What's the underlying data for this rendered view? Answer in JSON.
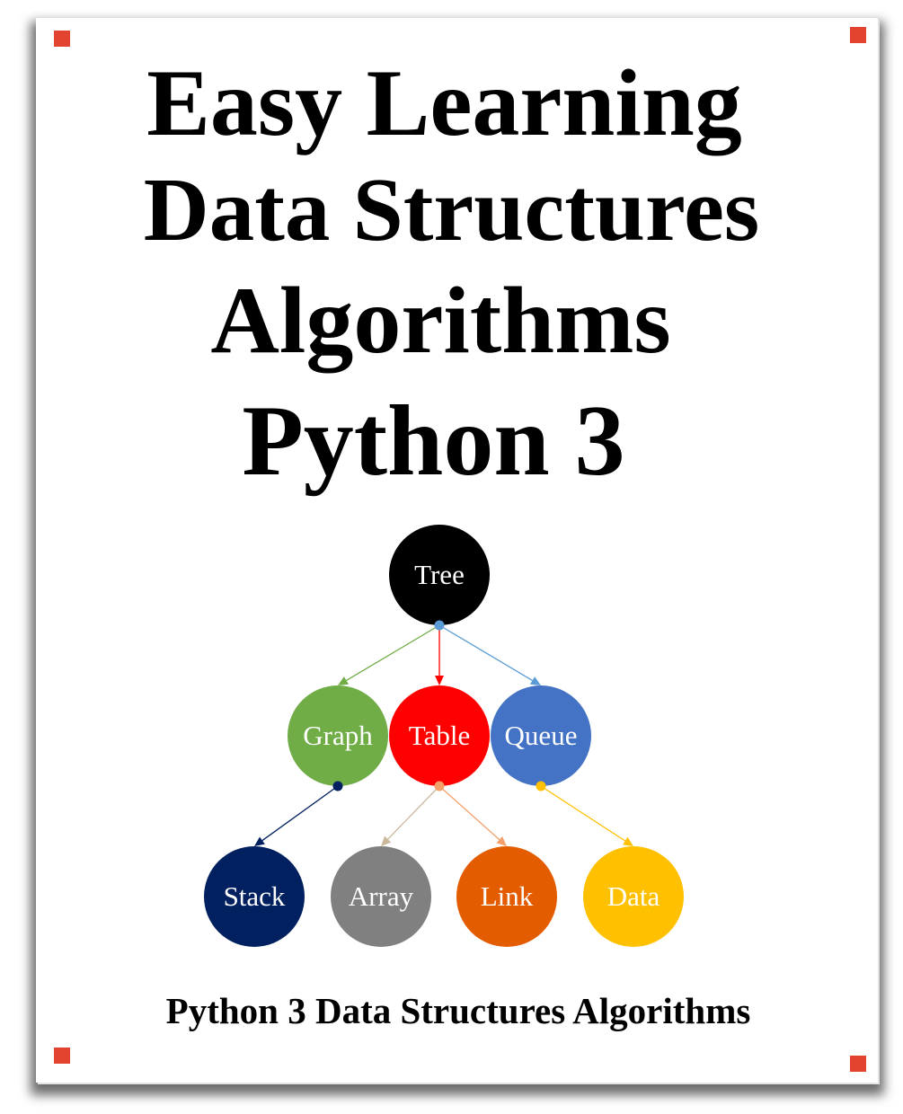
{
  "cover": {
    "title_lines": [
      "Easy Learning",
      "Data Structures",
      "Algorithms",
      "Python 3"
    ],
    "subtitle": "Python 3 Data Structures Algorithms",
    "accent_color": "#e2442f"
  },
  "diagram": {
    "nodes": [
      {
        "id": "tree",
        "label": "Tree",
        "color": "#000000"
      },
      {
        "id": "graph",
        "label": "Graph",
        "color": "#70ad47"
      },
      {
        "id": "table",
        "label": "Table",
        "color": "#ff0000"
      },
      {
        "id": "queue",
        "label": "Queue",
        "color": "#4472c4"
      },
      {
        "id": "stack",
        "label": "Stack",
        "color": "#002060"
      },
      {
        "id": "array",
        "label": "Array",
        "color": "#808080"
      },
      {
        "id": "link",
        "label": "Link",
        "color": "#e35d00"
      },
      {
        "id": "data",
        "label": "Data",
        "color": "#ffc000"
      }
    ],
    "edges": [
      {
        "from": "tree",
        "to": "graph",
        "color": "#70ad47"
      },
      {
        "from": "tree",
        "to": "table",
        "color": "#ff0000"
      },
      {
        "from": "tree",
        "to": "queue",
        "color": "#5b9bd5"
      },
      {
        "from": "graph",
        "to": "stack",
        "color": "#002060"
      },
      {
        "from": "table",
        "to": "array",
        "color": "#c9b99a"
      },
      {
        "from": "table",
        "to": "link",
        "color": "#f4a06b"
      },
      {
        "from": "queue",
        "to": "data",
        "color": "#ffc000"
      }
    ]
  }
}
